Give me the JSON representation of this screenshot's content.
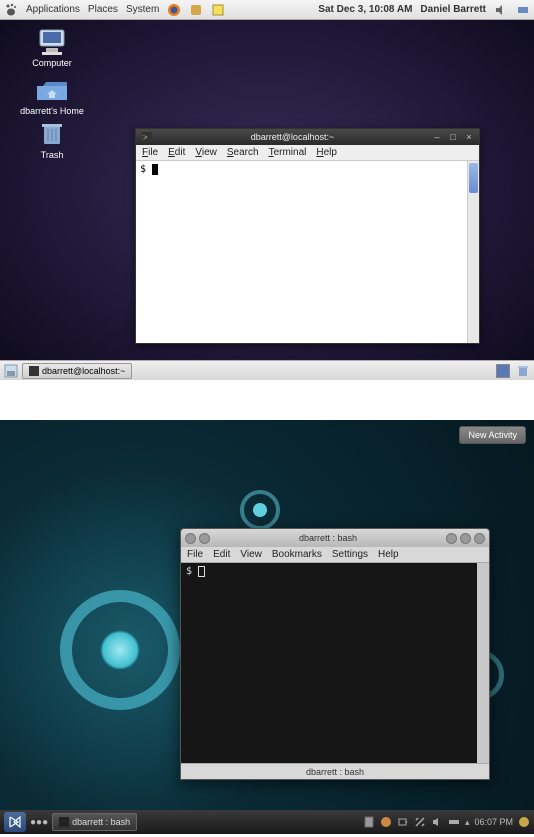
{
  "gnome": {
    "panel": {
      "menus": [
        "Applications",
        "Places",
        "System"
      ],
      "datetime": "Sat Dec  3, 10:08 AM",
      "username": "Daniel Barrett"
    },
    "desktop_icons": [
      {
        "label": "Computer"
      },
      {
        "label": "dbarrett's Home"
      },
      {
        "label": "Trash"
      }
    ],
    "terminal": {
      "title": "dbarrett@localhost:~",
      "menus": [
        "File",
        "Edit",
        "View",
        "Search",
        "Terminal",
        "Help"
      ],
      "prompt": "$"
    },
    "taskbar": {
      "task": "dbarrett@localhost:~"
    }
  },
  "kde": {
    "new_activity": "New Activity",
    "terminal": {
      "title": "dbarrett : bash",
      "menus": [
        "File",
        "Edit",
        "View",
        "Bookmarks",
        "Settings",
        "Help"
      ],
      "prompt": "$",
      "status": "dbarrett : bash"
    },
    "panel": {
      "task": "dbarrett : bash",
      "clock": "06:07 PM"
    }
  }
}
